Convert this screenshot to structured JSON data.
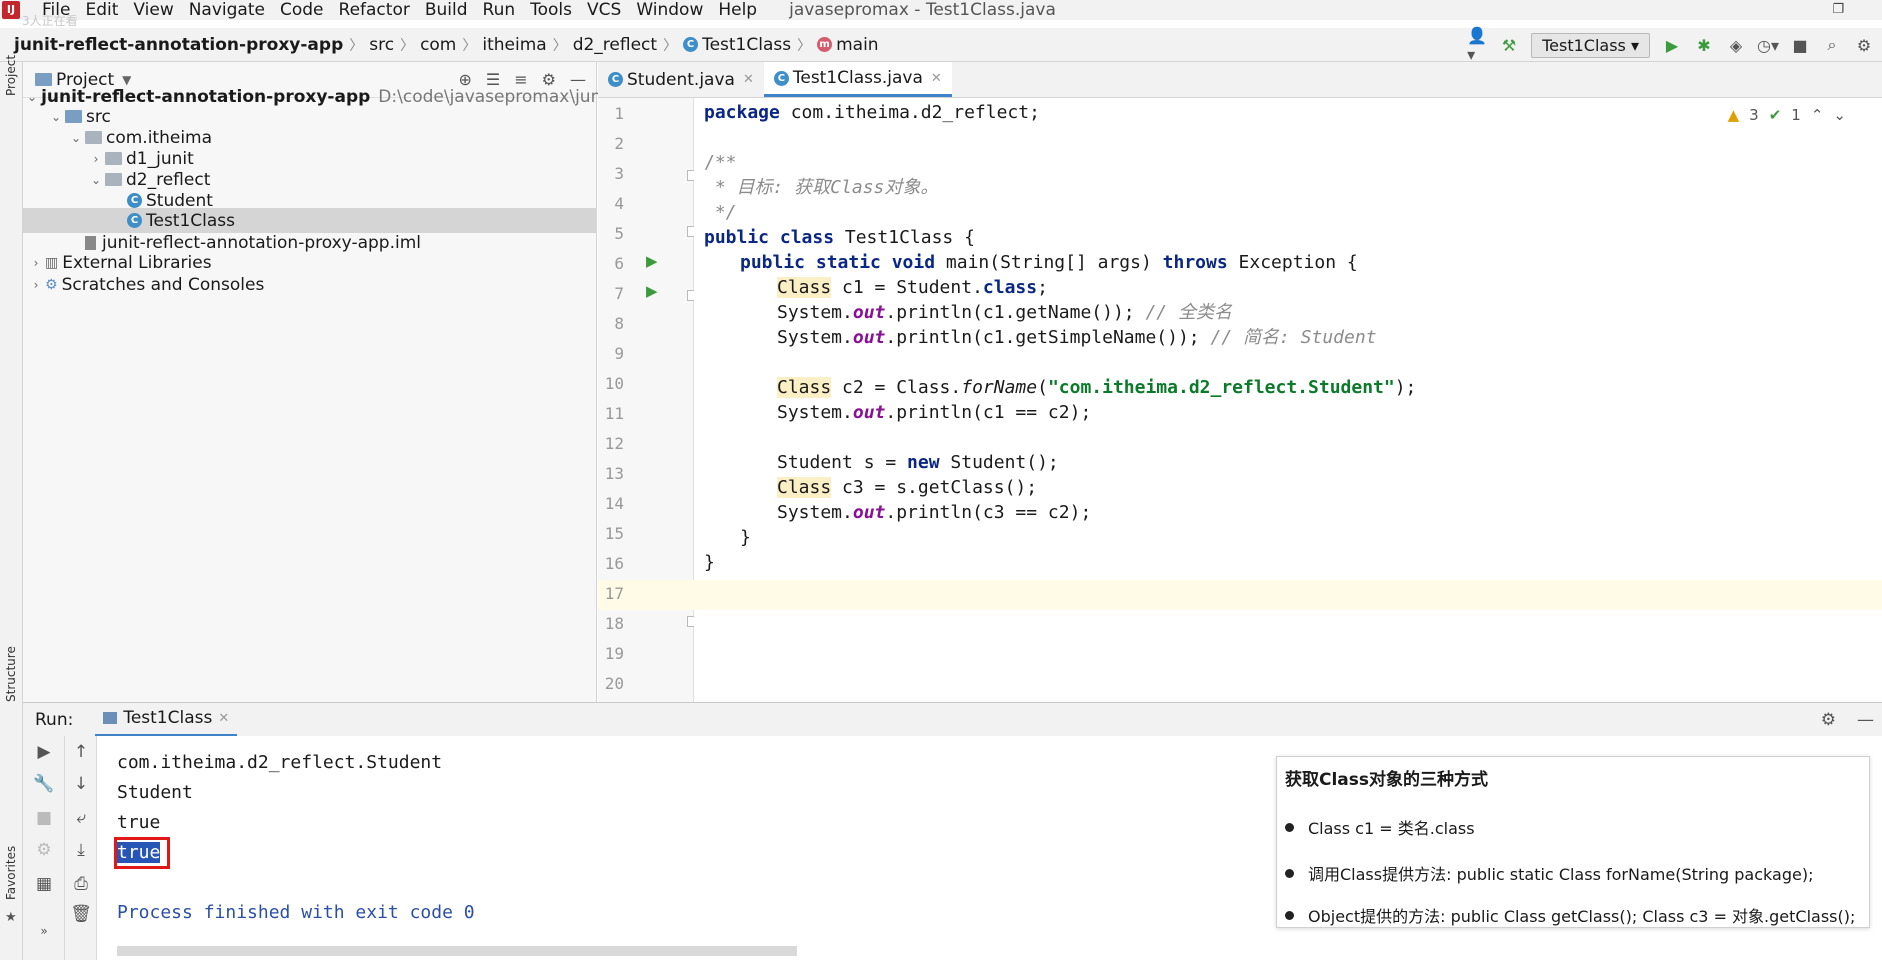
{
  "menubar": {
    "app_icon": "intellij-icon",
    "watching": "3人正在看",
    "items": [
      "File",
      "Edit",
      "View",
      "Navigate",
      "Code",
      "Refactor",
      "Build",
      "Run",
      "Tools",
      "VCS",
      "Window",
      "Help"
    ],
    "window_title": "javasepromax - Test1Class.java"
  },
  "navbar": {
    "crumbs": [
      "junit-reflect-annotation-proxy-app",
      "src",
      "com",
      "itheima",
      "d2_reflect",
      "Test1Class",
      "main"
    ],
    "run_config": "Test1Class"
  },
  "leftstrip": {
    "project_label": "Project",
    "structure_label": "Structure",
    "favorites_label": "Favorites"
  },
  "project": {
    "title": "Project",
    "tree": [
      {
        "label": "junit-reflect-annotation-proxy-app",
        "path": "D:\\code\\javasepromax\\junit-r",
        "type": "module",
        "arrow": "v"
      },
      {
        "label": "src",
        "type": "folder",
        "arrow": "v"
      },
      {
        "label": "com.itheima",
        "type": "package",
        "arrow": "v"
      },
      {
        "label": "d1_junit",
        "type": "package",
        "arrow": ">"
      },
      {
        "label": "d2_reflect",
        "type": "package",
        "arrow": "v"
      },
      {
        "label": "Student",
        "type": "class",
        "arrow": ""
      },
      {
        "label": "Test1Class",
        "type": "class",
        "arrow": ""
      },
      {
        "label": "junit-reflect-annotation-proxy-app.iml",
        "type": "file",
        "arrow": ""
      },
      {
        "label": "External Libraries",
        "type": "lib",
        "arrow": ">"
      },
      {
        "label": "Scratches and Consoles",
        "type": "scratch",
        "arrow": ">"
      }
    ]
  },
  "tabs": [
    {
      "label": "Student.java"
    },
    {
      "label": "Test1Class.java"
    }
  ],
  "inspections": {
    "warnings": "3",
    "checks": "1"
  },
  "code_lines": [
    "1",
    "2",
    "3",
    "4",
    "5",
    "6",
    "7",
    "8",
    "9",
    "10",
    "11",
    "12",
    "13",
    "14",
    "15",
    "16",
    "17",
    "18",
    "19",
    "20"
  ],
  "code": {
    "l1_kw": "package",
    "l1_rest": " com.itheima.d2_reflect;",
    "l3": "/**",
    "l4": " * 目标: 获取Class对象。",
    "l5": " */",
    "l6_kw": "public class",
    "l6_rest": " Test1Class {",
    "l7_kw1": "public static void",
    "l7_mid": " main(String[] args) ",
    "l7_kw2": "throws",
    "l7_rest": " Exception {",
    "l8_hl": "Class",
    "l8_mid": " c1 = Student.",
    "l8_kw": "class",
    "l8_end": ";",
    "l9_a": "System.",
    "l9_f": "out",
    "l9_b": ".println(c1.getName()); ",
    "l9_c": "// 全类名",
    "l10_a": "System.",
    "l10_f": "out",
    "l10_b": ".println(c1.getSimpleName()); ",
    "l10_c": "// 简名: Student",
    "l12_hl": "Class",
    "l12_mid": " c2 = Class.",
    "l12_it": "forName",
    "l12_p": "(",
    "l12_str": "\"com.itheima.d2_reflect.Student\"",
    "l12_end": ");",
    "l13_a": "System.",
    "l13_f": "out",
    "l13_b": ".println(c1 == c2);",
    "l15_a": "Student s = ",
    "l15_kw": "new",
    "l15_b": " Student();",
    "l16_hl": "Class",
    "l16_b": " c3 = s.getClass();",
    "l17_a": "System.",
    "l17_f": "out",
    "l17_b": ".println(c3 == c2);",
    "l18": "}",
    "l19": "}"
  },
  "run": {
    "label": "Run:",
    "tab": "Test1Class",
    "output": [
      "com.itheima.d2_reflect.Student",
      "Student",
      "true",
      "true",
      "",
      "Process finished with exit code 0"
    ]
  },
  "popup": {
    "title": "获取Class对象的三种方式",
    "items": [
      "Class c1 = 类名.class",
      "调用Class提供方法: public static Class forName(String package);",
      "Object提供的方法:  public Class getClass();   Class c3 = 对象.getClass();"
    ]
  }
}
